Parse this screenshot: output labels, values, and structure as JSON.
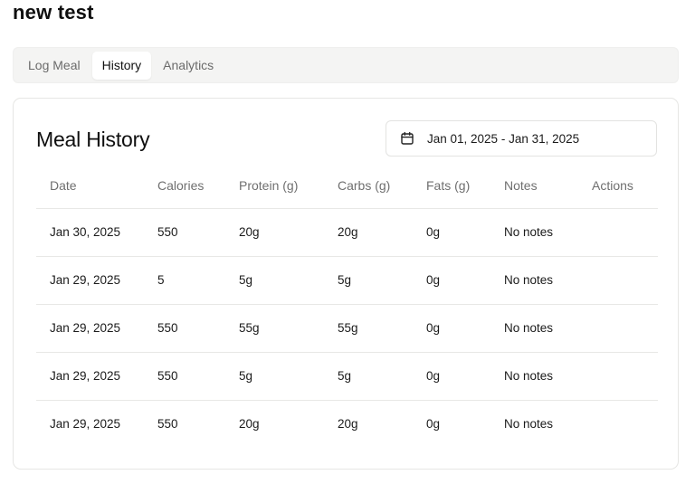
{
  "app": {
    "title": "new test"
  },
  "tabs": [
    {
      "label": "Log Meal",
      "active": false
    },
    {
      "label": "History",
      "active": true
    },
    {
      "label": "Analytics",
      "active": false
    }
  ],
  "history": {
    "title": "Meal History",
    "date_range": {
      "icon": "calendar-icon",
      "value": "Jan 01, 2025 - Jan 31, 2025"
    },
    "columns": [
      "Date",
      "Calories",
      "Protein (g)",
      "Carbs (g)",
      "Fats (g)",
      "Notes",
      "Actions"
    ],
    "rows": [
      {
        "date": "Jan 30, 2025",
        "calories": "550",
        "protein": "20g",
        "carbs": "20g",
        "fats": "0g",
        "notes": "No notes"
      },
      {
        "date": "Jan 29, 2025",
        "calories": "5",
        "protein": "5g",
        "carbs": "5g",
        "fats": "0g",
        "notes": "No notes"
      },
      {
        "date": "Jan 29, 2025",
        "calories": "550",
        "protein": "55g",
        "carbs": "55g",
        "fats": "0g",
        "notes": "No notes"
      },
      {
        "date": "Jan 29, 2025",
        "calories": "550",
        "protein": "5g",
        "carbs": "5g",
        "fats": "0g",
        "notes": "No notes"
      },
      {
        "date": "Jan 29, 2025",
        "calories": "550",
        "protein": "20g",
        "carbs": "20g",
        "fats": "0g",
        "notes": "No notes"
      }
    ]
  }
}
